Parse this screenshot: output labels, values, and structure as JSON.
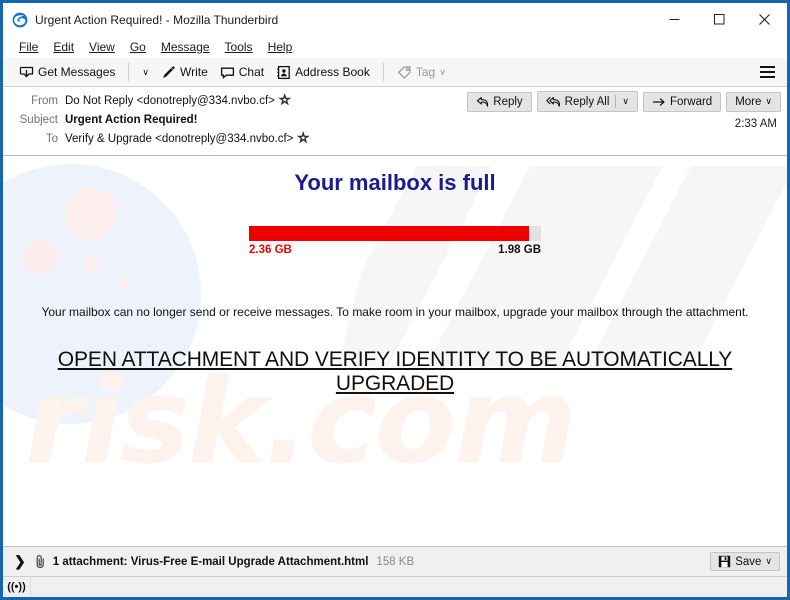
{
  "window": {
    "title": "Urgent Action Required! - Mozilla Thunderbird",
    "app_icon": "thunderbird-icon",
    "minimize_label": "‒",
    "maximize_label": "□",
    "close_label": "✕",
    "accent_color": "#1565b0"
  },
  "menubar": {
    "items": [
      {
        "label": "File",
        "accel": "F"
      },
      {
        "label": "Edit",
        "accel": "E"
      },
      {
        "label": "View",
        "accel": "V"
      },
      {
        "label": "Go",
        "accel": "G"
      },
      {
        "label": "Message",
        "accel": "M"
      },
      {
        "label": "Tools",
        "accel": "T"
      },
      {
        "label": "Help",
        "accel": "H"
      }
    ]
  },
  "toolbar": {
    "get_messages": "Get Messages",
    "write": "Write",
    "chat": "Chat",
    "address_book": "Address Book",
    "tag": "Tag",
    "caret": "∨",
    "menu_label": "app-menu"
  },
  "message": {
    "from_label": "From",
    "from_value": "Do Not Reply <donotreply@334.nvbo.cf>",
    "subject_label": "Subject",
    "subject_value": "Urgent Action Required!",
    "to_label": "To",
    "to_value": "Verify & Upgrade <donotreply@334.nvbo.cf>",
    "timestamp": "2:33 AM",
    "star_glyph": "☆"
  },
  "actions": {
    "reply": "Reply",
    "reply_all": "Reply All",
    "forward": "Forward",
    "more": "More",
    "caret": "∨",
    "reply_icon": "reply-arrow-icon",
    "reply_all_icon": "reply-all-arrow-icon",
    "forward_icon": "forward-arrow-icon"
  },
  "body": {
    "heading": "Your mailbox is full",
    "heading_color": "#1b1b8f",
    "quota": {
      "used_label": "2.36 GB",
      "total_label": "1.98 GB",
      "used_color": "#ee0000",
      "track_color": "#e2e2e2",
      "fill_percent": 96
    },
    "paragraph": "Your mailbox can no longer send or receive messages. To make room in your mailbox, upgrade your mailbox through the attachment.",
    "cta_link": "OPEN ATTACHMENT AND VERIFY IDENTITY TO BE AUTOMATICALLY UPGRADED",
    "watermark_text": "risk.com"
  },
  "attachment": {
    "expander_glyph": "❯",
    "clip_icon": "paperclip-icon",
    "summary": "1 attachment: Virus-Free E-mail Upgrade Attachment.html",
    "size": "158 KB",
    "save_label": "Save",
    "save_caret": "∨"
  },
  "statusbar": {
    "connection_icon": "((•))"
  }
}
